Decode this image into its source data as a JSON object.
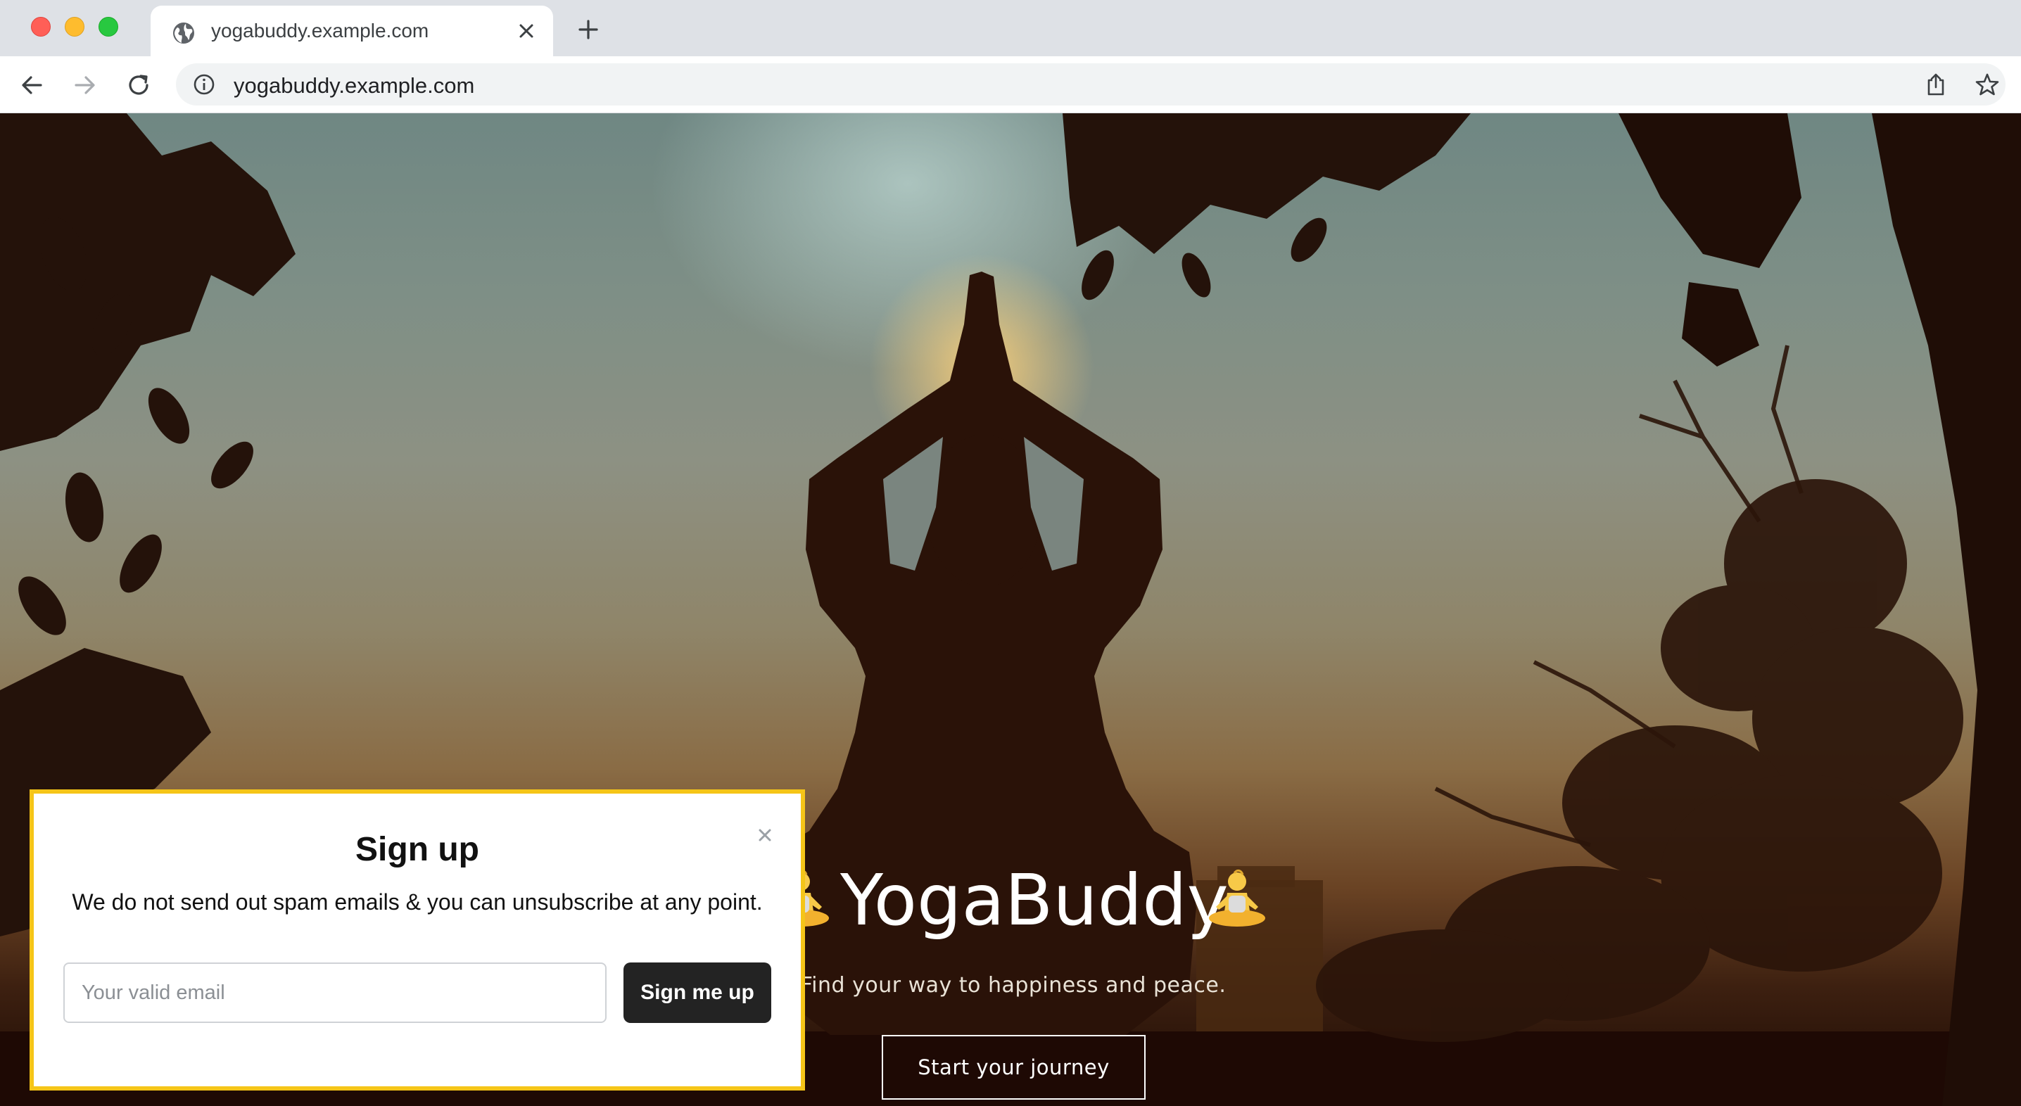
{
  "browser": {
    "tab": {
      "title": "yogabuddy.example.com",
      "icon": "globe-icon"
    },
    "address_bar": {
      "url": "yogabuddy.example.com"
    }
  },
  "hero": {
    "title": "YogaBuddy",
    "title_emoji": "🧘",
    "tagline": "Find your way to happiness and peace.",
    "cta_label": "Start your journey"
  },
  "signup_modal": {
    "title": "Sign up",
    "description": "We do not send out spam emails & you can unsubscribe at any point.",
    "email_placeholder": "Your valid email",
    "email_value": "",
    "submit_label": "Sign me up",
    "close_glyph": "×"
  },
  "colors": {
    "modal_border": "#f5c518",
    "submit_button": "#232323",
    "tab_bar": "#dee1e6"
  }
}
